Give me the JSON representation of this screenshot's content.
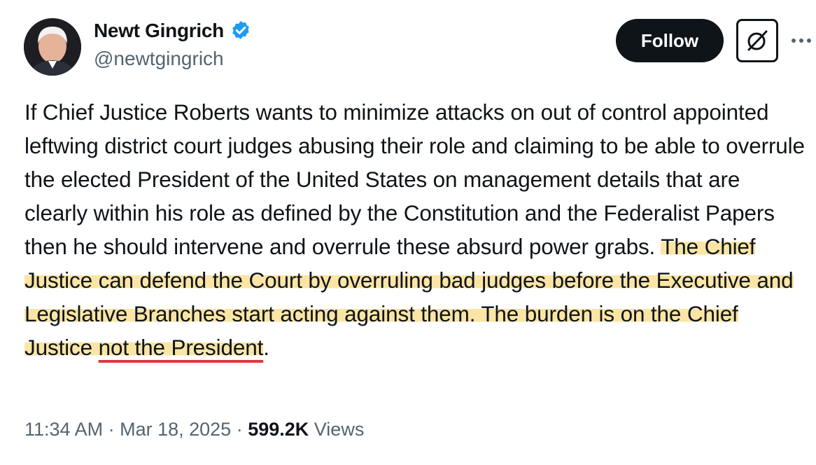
{
  "author": {
    "display_name": "Newt Gingrich",
    "handle": "@newtgingrich",
    "verified": true,
    "verified_color": "#1d9bf0",
    "avatar_icon": "profile-photo"
  },
  "actions": {
    "follow_label": "Follow",
    "grok_icon": "grok-icon",
    "more_icon": "more-horizontal-icon"
  },
  "tweet": {
    "text_plain": "If Chief Justice Roberts wants to minimize attacks on out of control appointed leftwing district court judges abusing their role and claiming to be able to overrule the elected President of the United States on management details that are clearly within his role as defined by the Constitution and the Federalist Papers then he should intervene and overrule these absurd power grabs. ",
    "text_highlight": "The Chief Justice can defend the Court by overruling bad judges before the Executive and Legislative Branches start acting against them. The burden is on the Chief Justice ",
    "text_underlined": "not the President",
    "text_end": ".",
    "highlight_color": "#fadc8c",
    "underline_color": "#e0383e"
  },
  "meta": {
    "time": "11:34 AM",
    "separator": " · ",
    "date": "Mar 18, 2025",
    "views_count": "599.2K",
    "views_label": "Views"
  }
}
